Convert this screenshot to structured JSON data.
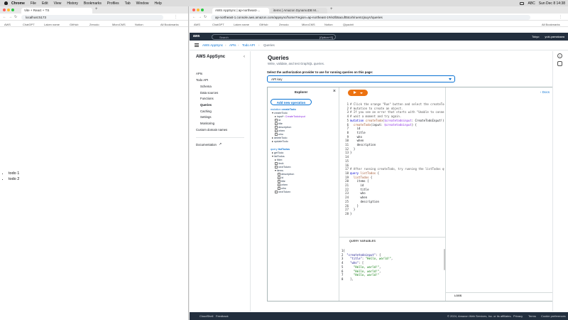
{
  "menubar": {
    "app": "Chrome",
    "items": [
      "File",
      "Edit",
      "View",
      "History",
      "Bookmarks",
      "Profiles",
      "Tab",
      "Window",
      "Help"
    ],
    "status": [
      "ABC"
    ],
    "clock": "Sun Dec 8  14:38"
  },
  "left_browser": {
    "tab_title": "Vite + React + TS",
    "url": "localhost:5173",
    "bookmarks": [
      "AWS",
      "ChatGPT",
      "Laken name",
      "GitHub",
      "Zenodo",
      "MicroCMS",
      "Notion",
      "All Bookmarks"
    ],
    "todos": [
      "todo 1",
      "todo 2"
    ]
  },
  "right_browser": {
    "tabs": [
      "AWS AppSync | ap-northeast-...",
      "items | Amazon DynamoDB M..."
    ],
    "url": "ap-northeast-1.console.aws.amazon.com/appsync/home?region=ap-northeast-1#/e2lb5acuft5tcxh/ruemzjsuyV/queries",
    "bookmarks": [
      "AWS",
      "ChatGPT",
      "Laken name",
      "GitHub",
      "Zenodo",
      "MicroCMS",
      "Notion",
      "Qiyaobit",
      "All Bookmarks"
    ]
  },
  "aws": {
    "logo": "aws",
    "search_placeholder": "Search",
    "search_kbd": "[Option+S]",
    "region": "Tokyo",
    "user": "yuki-yamakawa",
    "breadcrumbs": [
      "AWS AppSync",
      "APIs",
      "Todo API",
      "Queries"
    ],
    "sidenav": {
      "title": "AWS AppSync",
      "items": [
        "APIs",
        "Todo API",
        "Schema",
        "Data sources",
        "Functions",
        "Queries",
        "Caching",
        "Settings",
        "Monitoring",
        "Custom domain names",
        "Documentation"
      ]
    },
    "page": {
      "title": "Queries",
      "subtitle": "Write, validate, and test GraphQL queries.",
      "auth_label": "Select the authorization provider to use for running queries on this page:",
      "auth_value": "API key"
    },
    "explorer": {
      "title": "Explorer",
      "add_operation": "Add new operation",
      "mutation_label": "mutation",
      "mutation_name": "createTodo",
      "mutation_fields": [
        "createTodo",
        "input*:",
        "CreateTodoInput",
        "id",
        "title",
        "description",
        "when",
        "who",
        "deleteTodo",
        "updateTodo"
      ],
      "query_label": "query",
      "query_name": "listTodos",
      "query_fields": [
        "getTodo",
        "listTodos",
        "filter:",
        "limit:",
        "nextToken:",
        "items",
        "description",
        "id",
        "title",
        "when",
        "who",
        "nextToken"
      ]
    },
    "editor": {
      "code_lines": [
        "# Click the orange \"Run\" button and select the createTodo",
        "# mutation to create an object.",
        "# If you see an error that starts with \"Unable to connect\",",
        "# wait a moment and try again.",
        "mutation createTodo($createtodoinput: CreateTodoInput!) {",
        "  createTodo(input: $createtodoinput) {",
        "    id",
        "    title",
        "    who",
        "    when",
        "    description",
        "  }",
        "}",
        "",
        "",
        "",
        "# After running createTodo, try running the listTodos query.",
        "query listTodos {",
        "  listTodos {",
        "    items {",
        "      id",
        "      title",
        "      who",
        "      when",
        "      description",
        "    }",
        "  }",
        "}"
      ],
      "query_variables_label": "QUERY VARIABLES",
      "variables_lines": [
        "{",
        "  \"createtodoinput\": {",
        "    \"title\": \"Hello, world!\",",
        "    \"who\": [",
        "      \"Hello, world!\",",
        "      \"Hello, world!\",",
        "      \"Hello, world!\"",
        "    ],"
      ]
    },
    "results": {
      "docs_label": "Docs",
      "logs_label": "LOGS"
    },
    "footer": {
      "cloudshell": "CloudShell",
      "feedback": "Feedback",
      "copyright": "© 2024, Amazon Web Services, Inc. or its affiliates.",
      "privacy": "Privacy",
      "terms": "Terms",
      "cookies": "Cookie preferences"
    }
  },
  "colors": {
    "aws_nav": "#232f3e",
    "link": "#0972d3",
    "run_button": "#ec7211"
  }
}
